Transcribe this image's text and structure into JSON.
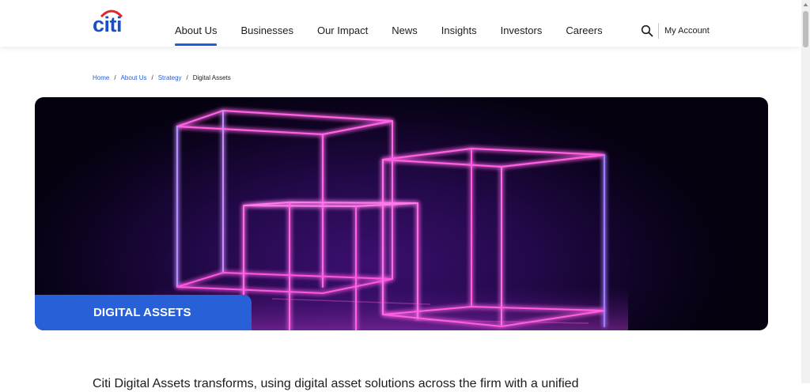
{
  "header": {
    "logo_text": "citi",
    "nav": [
      "About Us",
      "Businesses",
      "Our Impact",
      "News",
      "Insights",
      "Investors",
      "Careers"
    ],
    "active_nav": "About Us",
    "search_icon": "search-icon",
    "account_label": "My Account"
  },
  "breadcrumb": {
    "items": [
      "Home",
      "About Us",
      "Strategy"
    ],
    "current": "Digital Assets",
    "separator": "/"
  },
  "hero": {
    "label": "DIGITAL ASSETS",
    "image": "neon-wireframe-cubes-image"
  },
  "intro": {
    "text": "Citi Digital Assets transforms, using digital asset solutions across the firm with a unified"
  },
  "colors": {
    "brand_blue": "#1a4fc7",
    "accent_blue": "#2860d8",
    "neon_pink": "#ff4fd8",
    "neon_violet": "#9c6bff",
    "dark_bg": "#0d0320"
  }
}
